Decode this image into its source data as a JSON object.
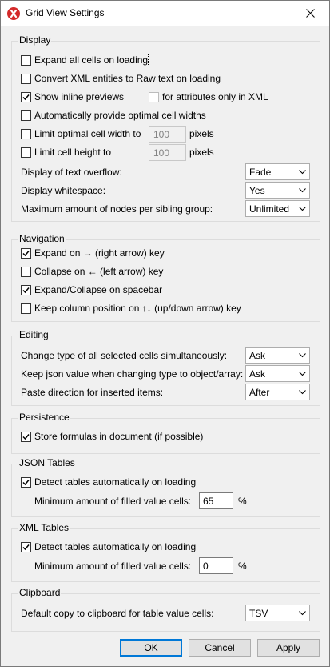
{
  "window": {
    "title": "Grid View Settings"
  },
  "display": {
    "title": "Display",
    "expand_all": "Expand all cells on loading",
    "convert_xml": "Convert XML entities to Raw text on loading",
    "inline_previews": "Show inline previews",
    "attrs_only": "for attributes only in XML",
    "optimal_widths": "Automatically provide optimal cell widths",
    "limit_width": "Limit optimal cell width to",
    "limit_width_value": "100",
    "limit_width_unit": "pixels",
    "limit_height": "Limit cell height to",
    "limit_height_value": "100",
    "limit_height_unit": "pixels",
    "overflow_label": "Display of text overflow:",
    "overflow_value": "Fade",
    "whitespace_label": "Display whitespace:",
    "whitespace_value": "Yes",
    "maxnodes_label": "Maximum amount of nodes per sibling group:",
    "maxnodes_value": "Unlimited"
  },
  "navigation": {
    "title": "Navigation",
    "expand_right": "Expand on → (right arrow) key",
    "collapse_left": "Collapse on ← (left arrow) key",
    "expand_space": "Expand/Collapse on spacebar",
    "keep_column": "Keep column position on ↑↓ (up/down arrow) key"
  },
  "editing": {
    "title": "Editing",
    "change_type_label": "Change type of all selected cells simultaneously:",
    "change_type_value": "Ask",
    "keep_json_label": "Keep json value when changing type to object/array:",
    "keep_json_value": "Ask",
    "paste_label": "Paste direction for inserted items:",
    "paste_value": "After"
  },
  "persistence": {
    "title": "Persistence",
    "store_formulas": "Store formulas in document (if possible)"
  },
  "json_tables": {
    "title": "JSON Tables",
    "detect": "Detect tables automatically on loading",
    "min_label": "Minimum amount of filled value cells:",
    "min_value": "65",
    "unit": "%"
  },
  "xml_tables": {
    "title": "XML Tables",
    "detect": "Detect tables automatically on loading",
    "min_label": "Minimum amount of filled value cells:",
    "min_value": "0",
    "unit": "%"
  },
  "clipboard": {
    "title": "Clipboard",
    "copy_label": "Default copy to clipboard for table value cells:",
    "copy_value": "TSV"
  },
  "buttons": {
    "ok": "OK",
    "cancel": "Cancel",
    "apply": "Apply"
  },
  "states": {
    "expand_all": false,
    "convert_xml": false,
    "inline_previews": true,
    "attrs_only": false,
    "optimal_widths": false,
    "limit_width": false,
    "limit_height": false,
    "expand_right": true,
    "collapse_left": false,
    "expand_space": true,
    "keep_column": false,
    "store_formulas": true,
    "json_detect": true,
    "xml_detect": true
  }
}
